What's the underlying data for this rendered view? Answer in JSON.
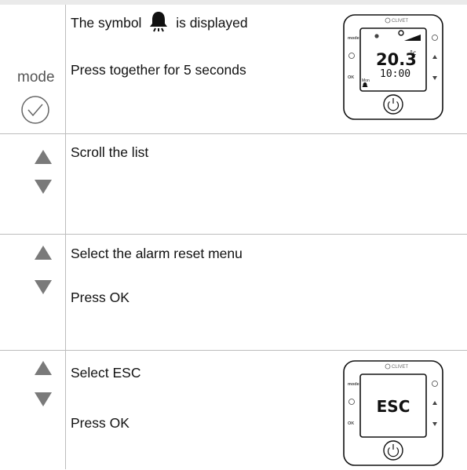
{
  "rows": [
    {
      "line1_prefix": "The symbol",
      "line1_suffix": "is displayed",
      "line2": "Press together for 5 seconds",
      "mode_label": "mode"
    },
    {
      "line1": "Scroll the list"
    },
    {
      "line1": "Select the alarm reset menu",
      "line2": "Press  OK"
    },
    {
      "line1": "Select ESC",
      "line2": "Press OK"
    }
  ],
  "device1": {
    "brand": "CLIVET",
    "left_buttons": [
      "mode",
      "OK"
    ],
    "temperature": "20.3",
    "unit": "°c",
    "time": "10:00",
    "day": "Mon"
  },
  "device2": {
    "brand": "CLIVET",
    "left_buttons": [
      "mode",
      "OK"
    ],
    "display": "ESC"
  },
  "colors": {
    "arrow": "#7a7a7a",
    "lines": "#bdbdbd",
    "text": "#111111"
  }
}
